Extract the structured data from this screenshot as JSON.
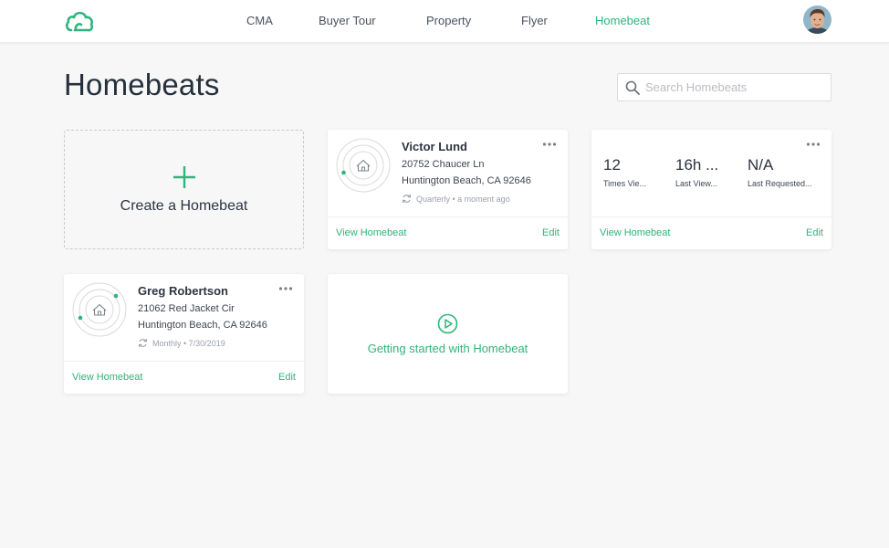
{
  "brand": {
    "accent": "#2fb47c",
    "logo_icon": "cloud-icon"
  },
  "nav": {
    "items": [
      {
        "label": "CMA"
      },
      {
        "label": "Buyer Tour"
      },
      {
        "label": "Property"
      },
      {
        "label": "Flyer"
      },
      {
        "label": "Homebeat",
        "active": true
      }
    ]
  },
  "page": {
    "title": "Homebeats",
    "search_placeholder": "Search Homebeats"
  },
  "create_card": {
    "label": "Create a Homebeat"
  },
  "homebeats": [
    {
      "name": "Victor Lund",
      "address_line1": "20752 Chaucer Ln",
      "address_line2": "Huntington Beach, CA 92646",
      "frequency": "Quarterly • a moment ago",
      "view_label": "View Homebeat",
      "edit_label": "Edit"
    },
    {
      "name": "Greg Robertson",
      "address_line1": "21062 Red Jacket Cir",
      "address_line2": "Huntington Beach, CA 92646",
      "frequency": "Monthly • 7/30/2019",
      "view_label": "View Homebeat",
      "edit_label": "Edit"
    }
  ],
  "stats_card": {
    "stats": [
      {
        "value": "12",
        "label": "Times Vie..."
      },
      {
        "value": "16h ...",
        "label": "Last View..."
      },
      {
        "value": "N/A",
        "label": "Last Requested..."
      }
    ],
    "view_label": "View Homebeat",
    "edit_label": "Edit"
  },
  "getting_started": {
    "label": "Getting started with Homebeat"
  }
}
